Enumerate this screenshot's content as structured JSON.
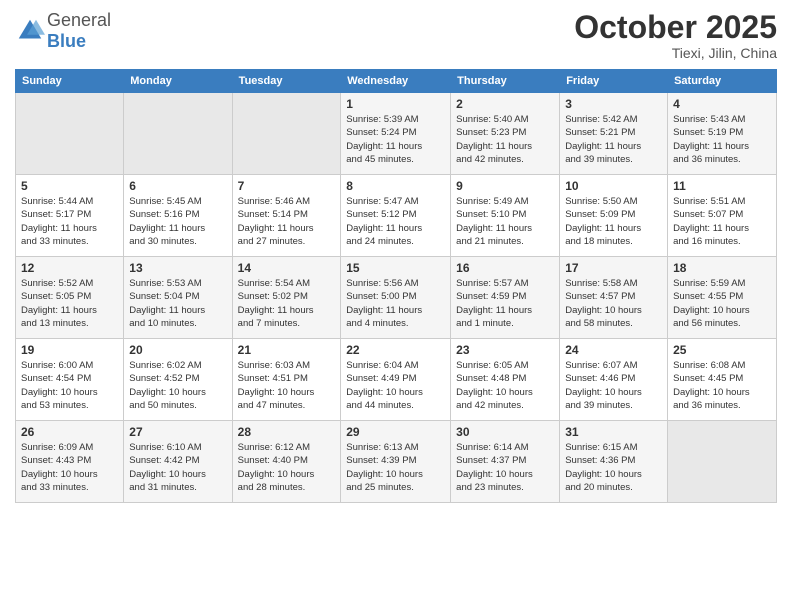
{
  "header": {
    "logo_general": "General",
    "logo_blue": "Blue",
    "month": "October 2025",
    "location": "Tiexi, Jilin, China"
  },
  "calendar": {
    "days_of_week": [
      "Sunday",
      "Monday",
      "Tuesday",
      "Wednesday",
      "Thursday",
      "Friday",
      "Saturday"
    ],
    "weeks": [
      [
        {
          "day": "",
          "detail": ""
        },
        {
          "day": "",
          "detail": ""
        },
        {
          "day": "",
          "detail": ""
        },
        {
          "day": "1",
          "detail": "Sunrise: 5:39 AM\nSunset: 5:24 PM\nDaylight: 11 hours\nand 45 minutes."
        },
        {
          "day": "2",
          "detail": "Sunrise: 5:40 AM\nSunset: 5:23 PM\nDaylight: 11 hours\nand 42 minutes."
        },
        {
          "day": "3",
          "detail": "Sunrise: 5:42 AM\nSunset: 5:21 PM\nDaylight: 11 hours\nand 39 minutes."
        },
        {
          "day": "4",
          "detail": "Sunrise: 5:43 AM\nSunset: 5:19 PM\nDaylight: 11 hours\nand 36 minutes."
        }
      ],
      [
        {
          "day": "5",
          "detail": "Sunrise: 5:44 AM\nSunset: 5:17 PM\nDaylight: 11 hours\nand 33 minutes."
        },
        {
          "day": "6",
          "detail": "Sunrise: 5:45 AM\nSunset: 5:16 PM\nDaylight: 11 hours\nand 30 minutes."
        },
        {
          "day": "7",
          "detail": "Sunrise: 5:46 AM\nSunset: 5:14 PM\nDaylight: 11 hours\nand 27 minutes."
        },
        {
          "day": "8",
          "detail": "Sunrise: 5:47 AM\nSunset: 5:12 PM\nDaylight: 11 hours\nand 24 minutes."
        },
        {
          "day": "9",
          "detail": "Sunrise: 5:49 AM\nSunset: 5:10 PM\nDaylight: 11 hours\nand 21 minutes."
        },
        {
          "day": "10",
          "detail": "Sunrise: 5:50 AM\nSunset: 5:09 PM\nDaylight: 11 hours\nand 18 minutes."
        },
        {
          "day": "11",
          "detail": "Sunrise: 5:51 AM\nSunset: 5:07 PM\nDaylight: 11 hours\nand 16 minutes."
        }
      ],
      [
        {
          "day": "12",
          "detail": "Sunrise: 5:52 AM\nSunset: 5:05 PM\nDaylight: 11 hours\nand 13 minutes."
        },
        {
          "day": "13",
          "detail": "Sunrise: 5:53 AM\nSunset: 5:04 PM\nDaylight: 11 hours\nand 10 minutes."
        },
        {
          "day": "14",
          "detail": "Sunrise: 5:54 AM\nSunset: 5:02 PM\nDaylight: 11 hours\nand 7 minutes."
        },
        {
          "day": "15",
          "detail": "Sunrise: 5:56 AM\nSunset: 5:00 PM\nDaylight: 11 hours\nand 4 minutes."
        },
        {
          "day": "16",
          "detail": "Sunrise: 5:57 AM\nSunset: 4:59 PM\nDaylight: 11 hours\nand 1 minute."
        },
        {
          "day": "17",
          "detail": "Sunrise: 5:58 AM\nSunset: 4:57 PM\nDaylight: 10 hours\nand 58 minutes."
        },
        {
          "day": "18",
          "detail": "Sunrise: 5:59 AM\nSunset: 4:55 PM\nDaylight: 10 hours\nand 56 minutes."
        }
      ],
      [
        {
          "day": "19",
          "detail": "Sunrise: 6:00 AM\nSunset: 4:54 PM\nDaylight: 10 hours\nand 53 minutes."
        },
        {
          "day": "20",
          "detail": "Sunrise: 6:02 AM\nSunset: 4:52 PM\nDaylight: 10 hours\nand 50 minutes."
        },
        {
          "day": "21",
          "detail": "Sunrise: 6:03 AM\nSunset: 4:51 PM\nDaylight: 10 hours\nand 47 minutes."
        },
        {
          "day": "22",
          "detail": "Sunrise: 6:04 AM\nSunset: 4:49 PM\nDaylight: 10 hours\nand 44 minutes."
        },
        {
          "day": "23",
          "detail": "Sunrise: 6:05 AM\nSunset: 4:48 PM\nDaylight: 10 hours\nand 42 minutes."
        },
        {
          "day": "24",
          "detail": "Sunrise: 6:07 AM\nSunset: 4:46 PM\nDaylight: 10 hours\nand 39 minutes."
        },
        {
          "day": "25",
          "detail": "Sunrise: 6:08 AM\nSunset: 4:45 PM\nDaylight: 10 hours\nand 36 minutes."
        }
      ],
      [
        {
          "day": "26",
          "detail": "Sunrise: 6:09 AM\nSunset: 4:43 PM\nDaylight: 10 hours\nand 33 minutes."
        },
        {
          "day": "27",
          "detail": "Sunrise: 6:10 AM\nSunset: 4:42 PM\nDaylight: 10 hours\nand 31 minutes."
        },
        {
          "day": "28",
          "detail": "Sunrise: 6:12 AM\nSunset: 4:40 PM\nDaylight: 10 hours\nand 28 minutes."
        },
        {
          "day": "29",
          "detail": "Sunrise: 6:13 AM\nSunset: 4:39 PM\nDaylight: 10 hours\nand 25 minutes."
        },
        {
          "day": "30",
          "detail": "Sunrise: 6:14 AM\nSunset: 4:37 PM\nDaylight: 10 hours\nand 23 minutes."
        },
        {
          "day": "31",
          "detail": "Sunrise: 6:15 AM\nSunset: 4:36 PM\nDaylight: 10 hours\nand 20 minutes."
        },
        {
          "day": "",
          "detail": ""
        }
      ]
    ]
  }
}
